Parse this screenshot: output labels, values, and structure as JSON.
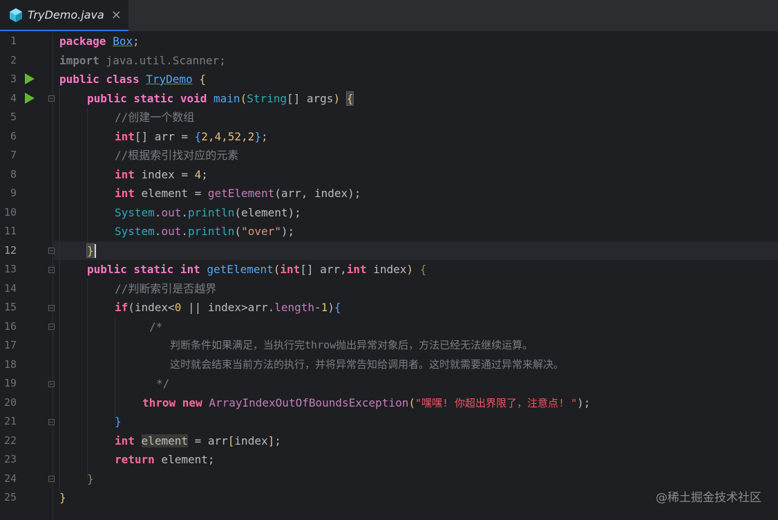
{
  "tab": {
    "filename": "TryDemo.java",
    "close": "×"
  },
  "watermark": "@稀土掘金技术社区",
  "lines": [
    {
      "n": "1"
    },
    {
      "n": "2"
    },
    {
      "n": "3"
    },
    {
      "n": "4"
    },
    {
      "n": "5"
    },
    {
      "n": "6"
    },
    {
      "n": "7"
    },
    {
      "n": "8"
    },
    {
      "n": "9"
    },
    {
      "n": "10"
    },
    {
      "n": "11"
    },
    {
      "n": "12"
    },
    {
      "n": "13"
    },
    {
      "n": "14"
    },
    {
      "n": "15"
    },
    {
      "n": "16"
    },
    {
      "n": "17"
    },
    {
      "n": "18"
    },
    {
      "n": "19"
    },
    {
      "n": "20"
    },
    {
      "n": "21"
    },
    {
      "n": "22"
    },
    {
      "n": "23"
    },
    {
      "n": "24"
    },
    {
      "n": "25"
    }
  ],
  "code": {
    "l1_kw": "package",
    "l1_pkg": "Box",
    "l1_end": ";",
    "l2_kw": "import",
    "l2_rest": " java.util.Scanner;",
    "l3_kw": "public class",
    "l3_cls": "TryDemo",
    "l3_brace": "{",
    "l4_kw": "public static void",
    "l4_meth": "main",
    "l4_p1": "(",
    "l4_type": "String",
    "l4_arr": "[] args",
    "l4_p2": ")",
    "l4_brace": "{",
    "l5_cmt": "//创建一个数组",
    "l6_kw": "int",
    "l6_rest": "[] arr = ",
    "l6_ob": "{",
    "l6_n": "2,4,52,2",
    "l6_cb": "}",
    "l6_end": ";",
    "l7_cmt": "//根据索引找对应的元素",
    "l8_kw": "int",
    "l8_rest": " index = ",
    "l8_num": "4",
    "l8_end": ";",
    "l9_kw": "int",
    "l9_rest": " element = ",
    "l9_meth": "getElement",
    "l9_args": "(arr, index);",
    "l10_sys": "System",
    "l10_dot": ".",
    "l10_out": "out",
    "l10_dot2": ".",
    "l10_m": "println",
    "l10_args": "(element);",
    "l11_sys": "System",
    "l11_dot": ".",
    "l11_out": "out",
    "l11_dot2": ".",
    "l11_m": "println",
    "l11_p1": "(",
    "l11_str": "\"over\"",
    "l11_p2": ");",
    "l12_brace": "}",
    "l13_kw": "public static int",
    "l13_meth": "getElement",
    "l13_p1": "(",
    "l13_int": "int",
    "l13_mid": "[] arr,",
    "l13_int2": "int",
    "l13_rest": " index",
    "l13_p2": ")",
    "l13_brace": "{",
    "l14_cmt": "//判断索引是否越界",
    "l15_kw": "if",
    "l15_a": "(index<",
    "l15_n0": "0",
    "l15_b": " || index>arr.",
    "l15_len": "length",
    "l15_c": "-",
    "l15_n1": "1",
    "l15_d": ")",
    "l15_brace": "{",
    "l16_cmt": "/*",
    "l17_cmt": "判断条件如果满足，当执行完throw抛出异常对象后，方法已经无法继续运算。",
    "l18_cmt": "这时就会结束当前方法的执行，并将异常告知给调用者。这时就需要通过异常来解决。",
    "l19_cmt": "*/",
    "l20_kw": "throw new",
    "l20_cls": "ArrayIndexOutOfBoundsException",
    "l20_p1": "(",
    "l20_str": "\"嘿嘿! 你超出界限了，注意点! \"",
    "l20_p2": ");",
    "l21_brace": "}",
    "l22_kw": "int",
    "l22_var": "element",
    "l22_rest": " = arr",
    "l22_ob": "[",
    "l22_idx": "index",
    "l22_cb": "]",
    "l22_end": ";",
    "l23_kw": "return",
    "l23_rest": " element;",
    "l24_brace": "}",
    "l25_brace": "}"
  }
}
